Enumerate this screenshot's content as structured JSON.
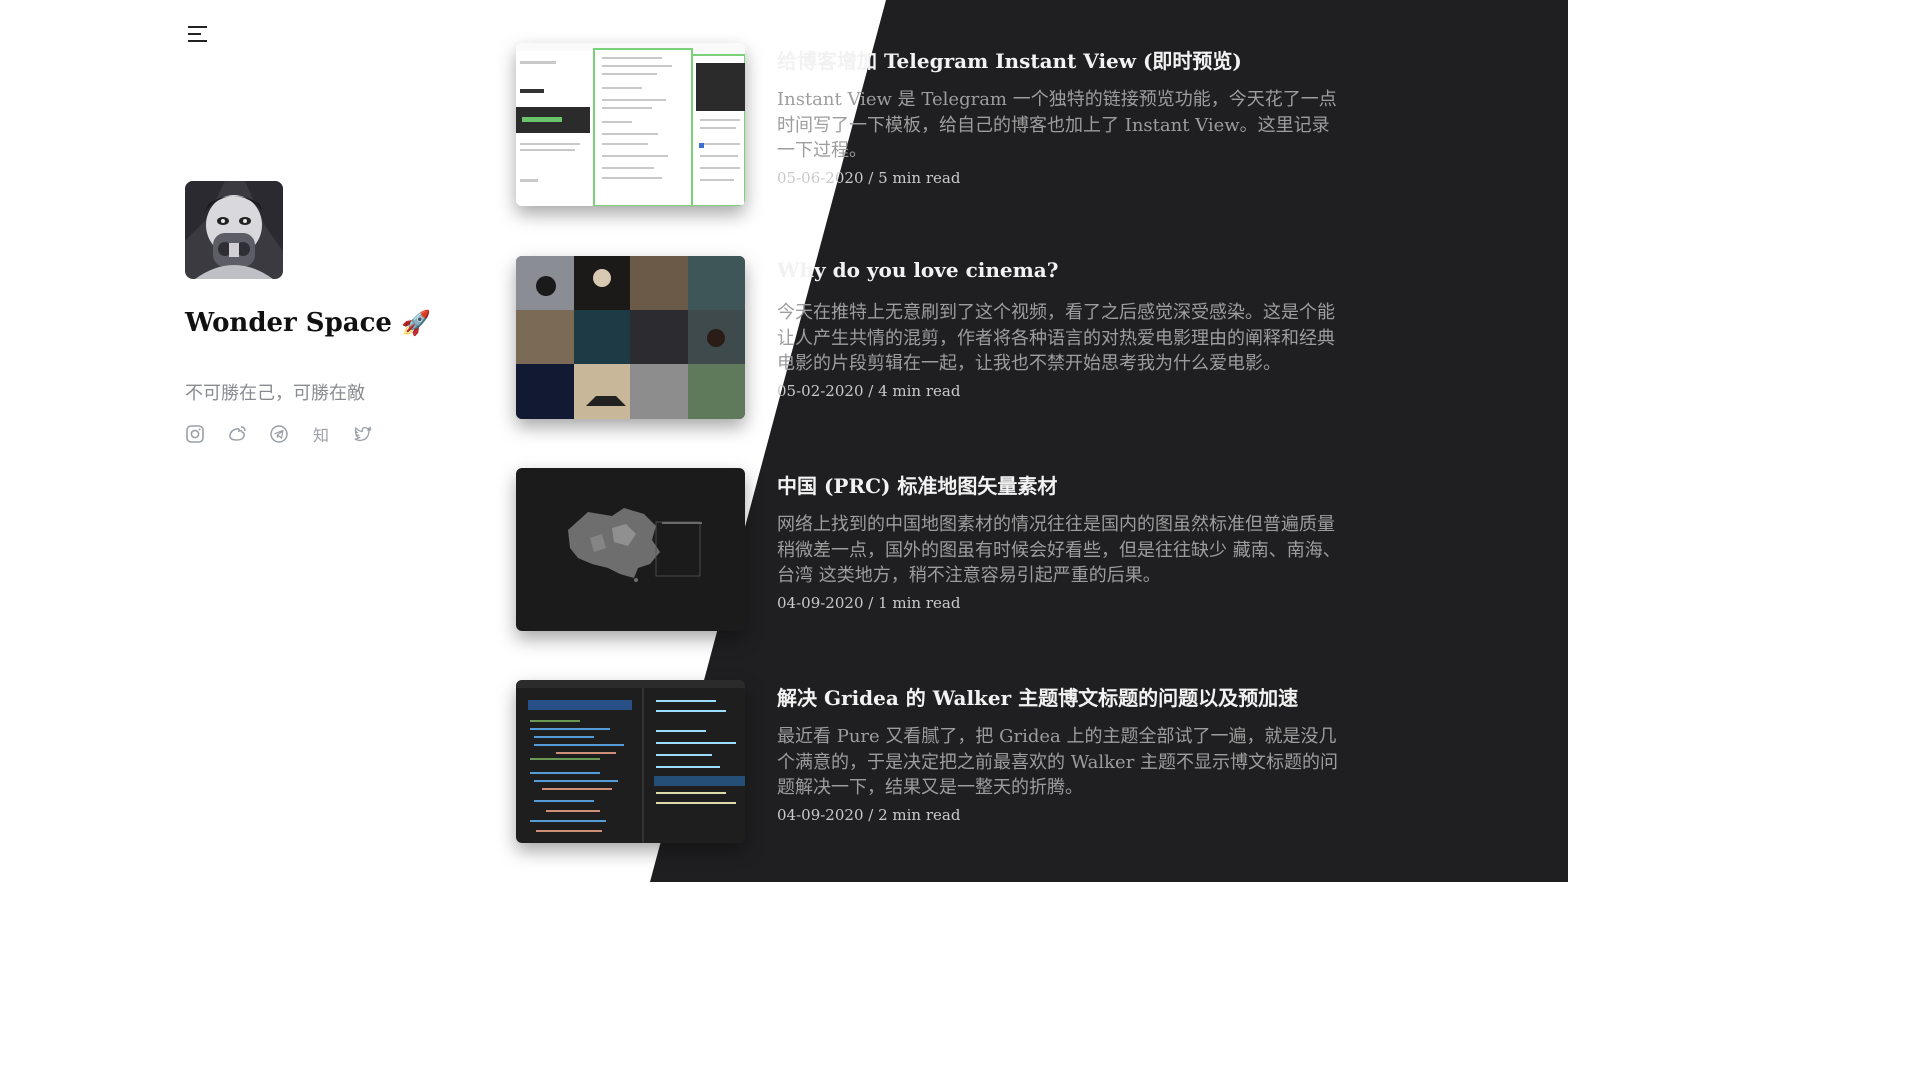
{
  "sidebar": {
    "menu_icon": "hamburger-menu-icon",
    "site_title": "Wonder Space",
    "title_emoji": "🚀",
    "subtitle": "不可勝在己，可勝在敵",
    "socials": [
      {
        "name": "instagram",
        "icon": "instagram-icon"
      },
      {
        "name": "weibo",
        "icon": "weibo-icon"
      },
      {
        "name": "telegram",
        "icon": "telegram-icon"
      },
      {
        "name": "zhihu",
        "icon": "zhihu-icon",
        "glyph": "知"
      },
      {
        "name": "twitter",
        "icon": "twitter-icon"
      }
    ]
  },
  "posts": [
    {
      "title": "给博客增加 Telegram Instant View (即时预览)",
      "excerpt": "Instant View 是 Telegram 一个独特的链接预览功能，今天花了一点时间写了一下模板，给自己的博客也加上了 Instant View。这里记录一下过程。",
      "date": "05-06-2020",
      "read_time": "5 min read",
      "meta": "05-06-2020 / 5 min read"
    },
    {
      "title": "Why do you love cinema?",
      "excerpt": "今天在推特上无意刷到了这个视频，看了之后感觉深受感染。这是个能让人产生共情的混剪，作者将各种语言的对热爱电影理由的阐释和经典电影的片段剪辑在一起，让我也不禁开始思考我为什么爱电影。",
      "date": "05-02-2020",
      "read_time": "4 min read",
      "meta": "05-02-2020 / 4 min read"
    },
    {
      "title": "中国 (PRC) 标准地图矢量素材",
      "excerpt": "网络上找到的中国地图素材的情况往往是国内的图虽然标准但普遍质量稍微差一点，国外的图虽有时候会好看些，但是往往缺少 藏南、南海、台湾 这类地方，稍不注意容易引起严重的后果。",
      "date": "04-09-2020",
      "read_time": "1 min read",
      "meta": "04-09-2020 / 1 min read"
    },
    {
      "title": "解决 Gridea 的 Walker 主题博文标题的问题以及预加速",
      "excerpt": "最近看 Pure 又看腻了，把 Gridea 上的主题全部试了一遍，就是没几个满意的，于是决定把之前最喜欢的 Walker 主题不显示博文标题的问题解决一下，结果又是一整天的折腾。",
      "date": "04-09-2020",
      "read_time": "2 min read",
      "meta": "04-09-2020 / 2 min read"
    }
  ],
  "colors": {
    "dark_panel": "#1f1f21",
    "title_light": "#f2f2f2",
    "excerpt_gray": "#9d9d9d",
    "subtitle_gray": "#888c91"
  }
}
